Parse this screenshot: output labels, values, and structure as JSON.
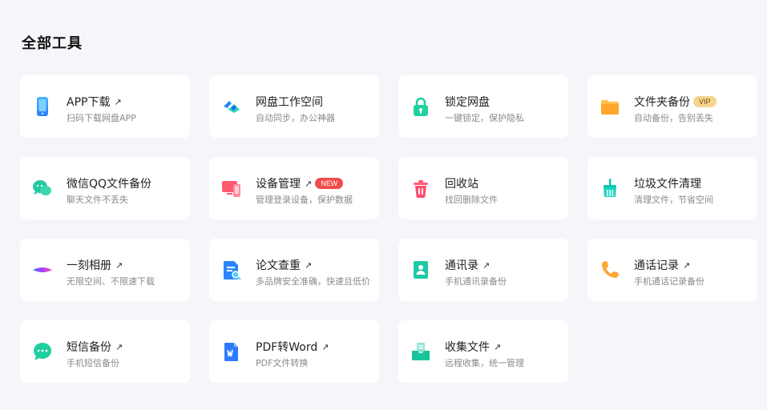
{
  "page": {
    "title": "全部工具"
  },
  "tools": [
    {
      "name": "APP下载",
      "desc": "扫码下载网盘APP",
      "arrow": "↗",
      "icon": "phone-icon"
    },
    {
      "name": "网盘工作空间",
      "desc": "自动同步，办公神器",
      "icon": "workspace-icon"
    },
    {
      "name": "锁定网盘",
      "desc": "一键锁定，保护隐私",
      "icon": "lock-icon"
    },
    {
      "name": "文件夹备份",
      "desc": "自动备份，告别丢失",
      "badge": "VIP",
      "icon": "folder-icon"
    },
    {
      "name": "微信QQ文件备份",
      "desc": "聊天文件不丢失",
      "icon": "chat-bubbles-icon"
    },
    {
      "name": "设备管理",
      "desc": "管理登录设备，保护数据",
      "arrow": "↗",
      "badge": "NEW",
      "icon": "devices-icon"
    },
    {
      "name": "回收站",
      "desc": "找回删除文件",
      "icon": "trash-icon"
    },
    {
      "name": "垃圾文件清理",
      "desc": "清理文件，节省空间",
      "icon": "broom-icon"
    },
    {
      "name": "一刻相册",
      "desc": "无限空间、不限速下载",
      "arrow": "↗",
      "icon": "album-icon"
    },
    {
      "name": "论文查重",
      "desc": "多品牌安全准确，快速且低价",
      "arrow": "↗",
      "icon": "paper-check-icon"
    },
    {
      "name": "通讯录",
      "desc": "手机通讯录备份",
      "arrow": "↗",
      "icon": "contacts-icon"
    },
    {
      "name": "通话记录",
      "desc": "手机通话记录备份",
      "arrow": "↗",
      "icon": "call-icon"
    },
    {
      "name": "短信备份",
      "desc": "手机短信备份",
      "arrow": "↗",
      "icon": "sms-icon"
    },
    {
      "name": "PDF转Word",
      "desc": "PDF文件转换",
      "arrow": "↗",
      "icon": "pdf-word-icon"
    },
    {
      "name": "收集文件",
      "desc": "远程收集，统一管理",
      "arrow": "↗",
      "icon": "collect-icon"
    }
  ]
}
